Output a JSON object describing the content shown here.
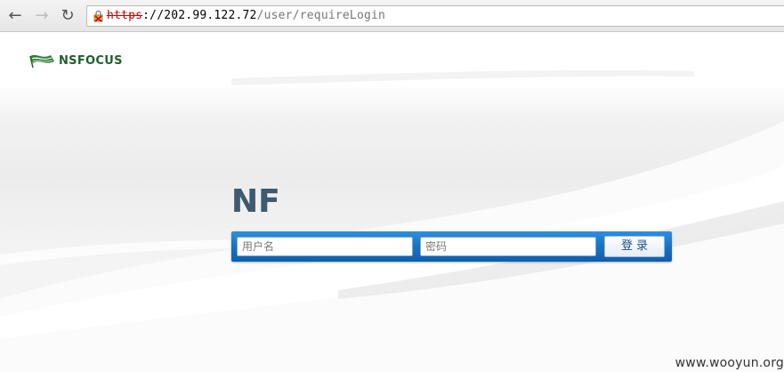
{
  "browser": {
    "url_scheme": "https",
    "url_host": "://202.99.122.72",
    "url_path": "/user/requireLogin",
    "icons": {
      "back": "back-arrow-icon",
      "forward": "forward-arrow-icon",
      "reload": "reload-icon",
      "security": "broken-lock-icon"
    }
  },
  "logo": {
    "text": "NSFOCUS"
  },
  "brand": {
    "title": "NF"
  },
  "login": {
    "username_placeholder": "用户名",
    "password_placeholder": "密码",
    "submit_label": "登录"
  },
  "watermark": {
    "text": "www.wooyun.org"
  },
  "colors": {
    "login_bar": "#1672c6",
    "logo_green": "#1f5f2e",
    "scheme_warning": "#cc0000"
  }
}
